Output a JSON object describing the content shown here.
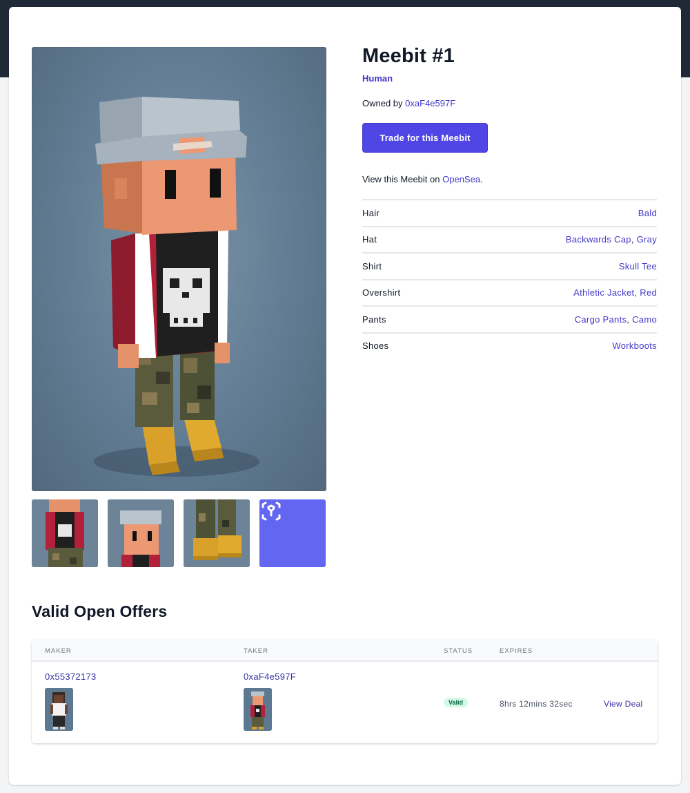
{
  "meebit": {
    "title": "Meebit #1",
    "type": "Human",
    "owned_prefix": "Owned by",
    "owner": "0xaF4e597F",
    "trade_button": "Trade for this Meebit",
    "view_prefix": "View this Meebit on",
    "view_link": "OpenSea",
    "view_suffix": "."
  },
  "traits": [
    {
      "name": "Hair",
      "values": [
        "Bald"
      ]
    },
    {
      "name": "Hat",
      "values": [
        "Backwards Cap",
        "Gray"
      ]
    },
    {
      "name": "Shirt",
      "values": [
        "Skull Tee"
      ]
    },
    {
      "name": "Overshirt",
      "values": [
        "Athletic Jacket",
        "Red"
      ]
    },
    {
      "name": "Pants",
      "values": [
        "Cargo Pants",
        "Camo"
      ]
    },
    {
      "name": "Shoes",
      "values": [
        "Workboots"
      ]
    }
  ],
  "thumbnails": [
    {
      "icon": "torso-view"
    },
    {
      "icon": "head-view"
    },
    {
      "icon": "boots-view"
    },
    {
      "icon": "ar-cube-icon"
    }
  ],
  "offers": {
    "title": "Valid Open Offers",
    "columns": {
      "maker": "MAKER",
      "taker": "TAKER",
      "status": "STATUS",
      "expires": "EXPIRES"
    },
    "rows": [
      {
        "maker": "0x55372173",
        "taker": "0xaF4e597F",
        "status": "Valid",
        "expires": "8hrs 12mins 32sec",
        "action": "View Deal"
      }
    ]
  },
  "colors": {
    "accent": "#4f46e5",
    "link": "#4338ca",
    "valid_badge_bg": "#d1fae5",
    "valid_badge_text": "#065f46",
    "header_band": "#1f2937"
  }
}
